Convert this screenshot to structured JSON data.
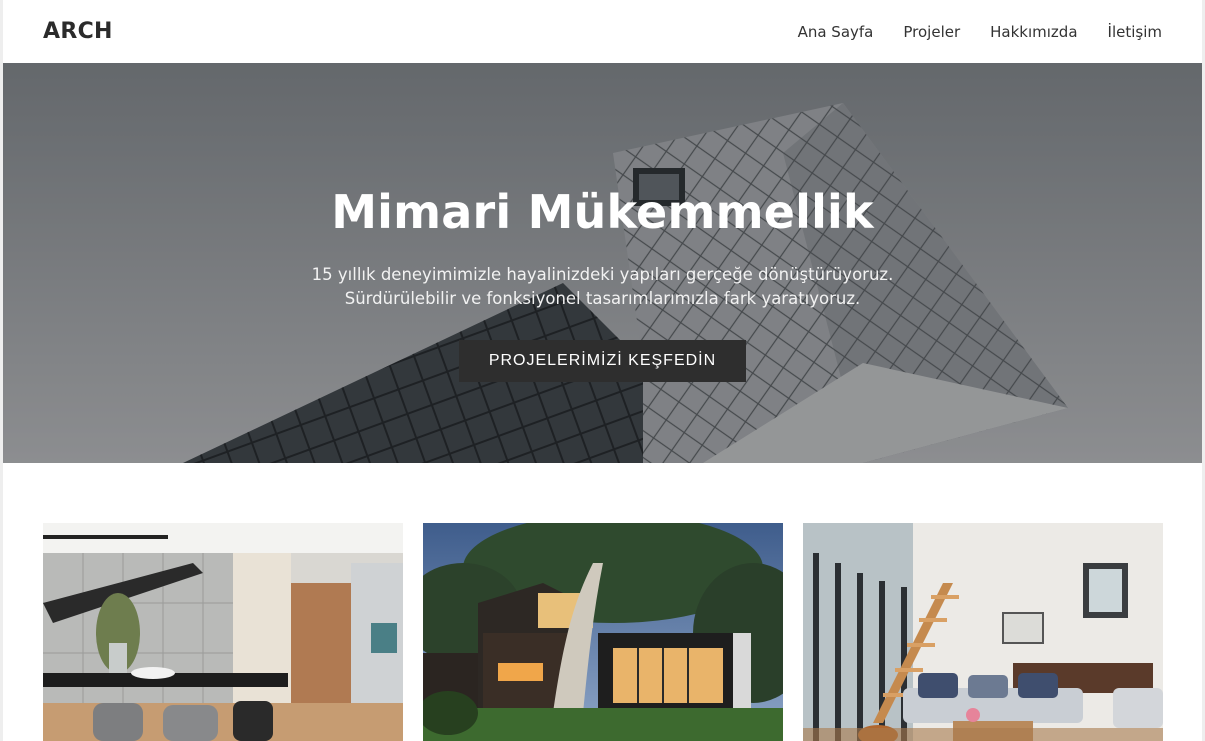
{
  "header": {
    "logo": "ARCH",
    "nav": [
      {
        "label": "Ana Sayfa"
      },
      {
        "label": "Projeler"
      },
      {
        "label": "Hakkımızda"
      },
      {
        "label": "İletişim"
      }
    ]
  },
  "hero": {
    "title": "Mimari Mükemmellik",
    "subtitle_line1": "15 yıllık deneyimimizle hayalinizdeki yapıları gerçeğe dönüştürüyoruz.",
    "subtitle_line2": "Sürdürülebilir ve fonksiyonel tasarımlarımızla fark yaratıyoruz.",
    "cta_label": "PROJELERİMİZİ KEŞFEDİN"
  },
  "projects": [
    {
      "image": "modern-dining-interior-photo"
    },
    {
      "image": "modern-house-exterior-dusk-photo"
    },
    {
      "image": "bright-living-room-interior-photo"
    }
  ],
  "colors": {
    "cta_background": "#2e2e2e",
    "header_background": "#ffffff"
  }
}
